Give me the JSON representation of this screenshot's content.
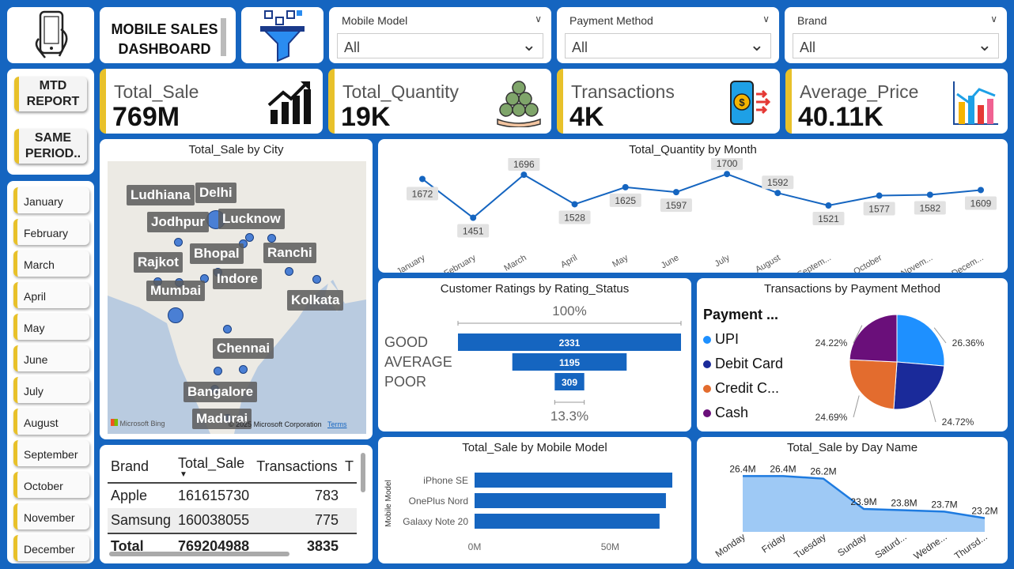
{
  "header": {
    "title_line1": "MOBILE SALES",
    "title_line2": "DASHBOARD"
  },
  "icons": {
    "phone": "phone-icon",
    "filter": "filter-funnel-icon",
    "sales": "growth-bars-icon",
    "quantity": "coins-hand-icon",
    "transactions": "mobile-payment-icon",
    "average": "bar-chart-icon"
  },
  "slicers": [
    {
      "label": "Mobile Model",
      "value": "All"
    },
    {
      "label": "Payment Method",
      "value": "All"
    },
    {
      "label": "Brand",
      "value": "All"
    }
  ],
  "nav": {
    "mtd_line1": "MTD",
    "mtd_line2": "REPORT",
    "same_line1": "SAME",
    "same_line2": "PERIOD.."
  },
  "months": [
    "January",
    "February",
    "March",
    "April",
    "May",
    "June",
    "July",
    "August",
    "September",
    "October",
    "November",
    "December"
  ],
  "kpis": [
    {
      "label": "Total_Sale",
      "value": "769M"
    },
    {
      "label": "Total_Quantity",
      "value": "19K"
    },
    {
      "label": "Transactions",
      "value": "4K"
    },
    {
      "label": "Average_Price",
      "value": "40.11K"
    }
  ],
  "map": {
    "title": "Total_Sale by City",
    "cities": [
      "Ludhiana",
      "Delhi",
      "Jodhpur",
      "Lucknow",
      "Bhopal",
      "Ranchi",
      "Rajkot",
      "Indore",
      "Mumbai",
      "Kolkata",
      "Chennai",
      "Bangalore",
      "Madurai"
    ],
    "attribution": "Microsoft Bing",
    "copyright": "© 2025 Microsoft Corporation",
    "terms": "Terms"
  },
  "table": {
    "headers": [
      "Brand",
      "Total_Sale",
      "Transactions",
      "T"
    ],
    "rows": [
      {
        "brand": "Apple",
        "sale": "161615730",
        "transactions": "783"
      },
      {
        "brand": "Samsung",
        "sale": "160038055",
        "transactions": "775"
      }
    ],
    "total": {
      "label": "Total",
      "sale": "769204988",
      "transactions": "3835"
    }
  },
  "accent_colors": {
    "kpi_bar": "#e8c12a",
    "primary_blue": "#1565c0",
    "bar_blue": "#1565c0"
  },
  "chart_data": [
    {
      "type": "line",
      "title": "Total_Quantity by Month",
      "categories": [
        "January",
        "February",
        "March",
        "April",
        "May",
        "June",
        "July",
        "August",
        "Septem...",
        "October",
        "Novem...",
        "Decem..."
      ],
      "values": [
        1672,
        1451,
        1696,
        1528,
        1625,
        1597,
        1700,
        1592,
        1521,
        1577,
        1582,
        1609
      ]
    },
    {
      "type": "bar",
      "title": "Customer Ratings by Rating_Status",
      "categories": [
        "GOOD",
        "AVERAGE",
        "POOR"
      ],
      "values": [
        2331,
        1195,
        309
      ],
      "top_label": "100%",
      "bottom_label": "13.3%"
    },
    {
      "type": "pie",
      "title": "Transactions by Payment Method",
      "legend_title": "Payment ...",
      "categories": [
        "UPI",
        "Debit Card",
        "Credit C...",
        "Cash"
      ],
      "values": [
        26.36,
        24.72,
        24.69,
        24.22
      ],
      "labels": [
        "26.36%",
        "24.72%",
        "24.69%",
        "24.22%"
      ],
      "colors": [
        "#1e90ff",
        "#1a2a9a",
        "#e36c2e",
        "#6a0f7a"
      ]
    },
    {
      "type": "bar",
      "title": "Total_Sale by Mobile Model",
      "ylabel": "Mobile Model",
      "categories": [
        "iPhone SE",
        "OnePlus Nord",
        "Galaxy Note 20"
      ],
      "values": [
        62,
        60,
        58
      ],
      "ticks": [
        "0M",
        "50M"
      ]
    },
    {
      "type": "area",
      "title": "Total_Sale by Day Name",
      "categories": [
        "Monday",
        "Friday",
        "Tuesday",
        "Sunday",
        "Saturd...",
        "Wedne...",
        "Thursd..."
      ],
      "values": [
        26.4,
        26.4,
        26.2,
        23.9,
        23.8,
        23.7,
        23.2
      ],
      "labels": [
        "26.4M",
        "26.4M",
        "26.2M",
        "23.9M",
        "23.8M",
        "23.7M",
        "23.2M"
      ]
    }
  ]
}
